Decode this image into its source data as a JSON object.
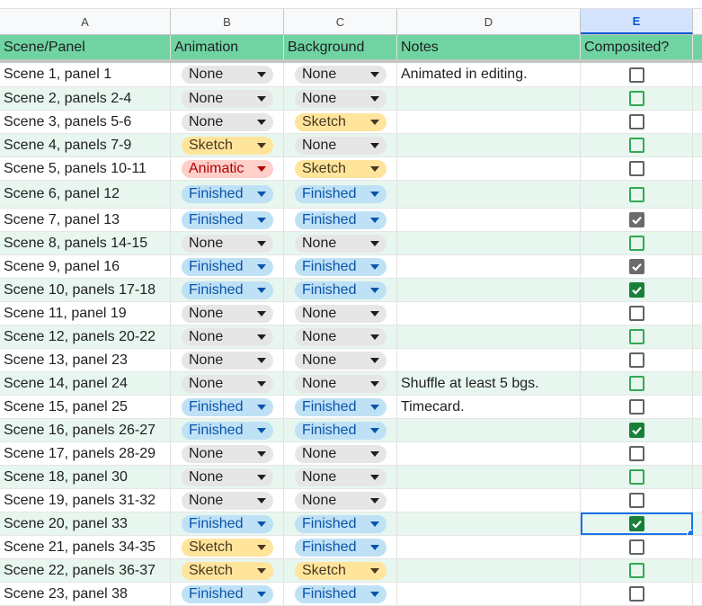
{
  "column_letters": [
    "A",
    "B",
    "C",
    "D",
    "E"
  ],
  "selected_column": "E",
  "headers": [
    "Scene/Panel",
    "Animation",
    "Background",
    "Notes",
    "Composited?"
  ],
  "colors": {
    "header_green": "#6fd4a2",
    "alt_row": "#e7f6ee",
    "none_chip": "#e6e6e6",
    "sketch_chip": "#ffe49c",
    "finished_chip": "#bfe1f6",
    "animatic_chip": "#ffcfc9",
    "selection_blue": "#1a73e8"
  },
  "selected_row_index": 19,
  "rows": [
    {
      "scene": "Scene 1, panel 1",
      "animation": "None",
      "background": "None",
      "notes": "Animated in editing.",
      "composited": false,
      "checked_style": "gray"
    },
    {
      "scene": "Scene 2, panels 2-4",
      "animation": "None",
      "background": "None",
      "notes": "",
      "composited": false,
      "checked_style": "green"
    },
    {
      "scene": "Scene 3, panels 5-6",
      "animation": "None",
      "background": "Sketch",
      "notes": "",
      "composited": false,
      "checked_style": "gray"
    },
    {
      "scene": "Scene 4, panels 7-9",
      "animation": "Sketch",
      "background": "None",
      "notes": "",
      "composited": false,
      "checked_style": "green"
    },
    {
      "scene": "Scene 5, panels 10-11",
      "animation": "Animatic",
      "background": "Sketch",
      "notes": "",
      "composited": false,
      "checked_style": "gray"
    },
    {
      "scene": "Scene 6, panel 12",
      "animation": "Finished",
      "background": "Finished",
      "notes": "",
      "composited": false,
      "checked_style": "green"
    },
    {
      "scene": "Scene 7, panel 13",
      "animation": "Finished",
      "background": "Finished",
      "notes": "",
      "composited": true,
      "checked_style": "gray"
    },
    {
      "scene": "Scene 8, panels 14-15",
      "animation": "None",
      "background": "None",
      "notes": "",
      "composited": false,
      "checked_style": "green"
    },
    {
      "scene": "Scene 9, panel 16",
      "animation": "Finished",
      "background": "Finished",
      "notes": "",
      "composited": true,
      "checked_style": "gray"
    },
    {
      "scene": "Scene 10, panels 17-18",
      "animation": "Finished",
      "background": "Finished",
      "notes": "",
      "composited": true,
      "checked_style": "green"
    },
    {
      "scene": "Scene 11, panel 19",
      "animation": "None",
      "background": "None",
      "notes": "",
      "composited": false,
      "checked_style": "gray"
    },
    {
      "scene": "Scene 12, panels 20-22",
      "animation": "None",
      "background": "None",
      "notes": "",
      "composited": false,
      "checked_style": "green"
    },
    {
      "scene": "Scene 13, panel 23",
      "animation": "None",
      "background": "None",
      "notes": "",
      "composited": false,
      "checked_style": "gray"
    },
    {
      "scene": "Scene 14, panel 24",
      "animation": "None",
      "background": "None",
      "notes": "Shuffle at least 5 bgs.",
      "composited": false,
      "checked_style": "green"
    },
    {
      "scene": "Scene 15, panel 25",
      "animation": "Finished",
      "background": "Finished",
      "notes": "Timecard.",
      "composited": false,
      "checked_style": "gray"
    },
    {
      "scene": "Scene 16, panels 26-27",
      "animation": "Finished",
      "background": "Finished",
      "notes": "",
      "composited": true,
      "checked_style": "green"
    },
    {
      "scene": "Scene 17, panels 28-29",
      "animation": "None",
      "background": "None",
      "notes": "",
      "composited": false,
      "checked_style": "gray"
    },
    {
      "scene": "Scene 18, panel 30",
      "animation": "None",
      "background": "None",
      "notes": "",
      "composited": false,
      "checked_style": "green"
    },
    {
      "scene": "Scene 19, panels 31-32",
      "animation": "None",
      "background": "None",
      "notes": "",
      "composited": false,
      "checked_style": "gray"
    },
    {
      "scene": "Scene 20, panel 33",
      "animation": "Finished",
      "background": "Finished",
      "notes": "",
      "composited": true,
      "checked_style": "green"
    },
    {
      "scene": "Scene 21, panels 34-35",
      "animation": "Sketch",
      "background": "Finished",
      "notes": "",
      "composited": false,
      "checked_style": "gray"
    },
    {
      "scene": "Scene 22, panels 36-37",
      "animation": "Sketch",
      "background": "Sketch",
      "notes": "",
      "composited": false,
      "checked_style": "green"
    },
    {
      "scene": "Scene 23, panel 38",
      "animation": "Finished",
      "background": "Finished",
      "notes": "",
      "composited": false,
      "checked_style": "gray"
    }
  ]
}
